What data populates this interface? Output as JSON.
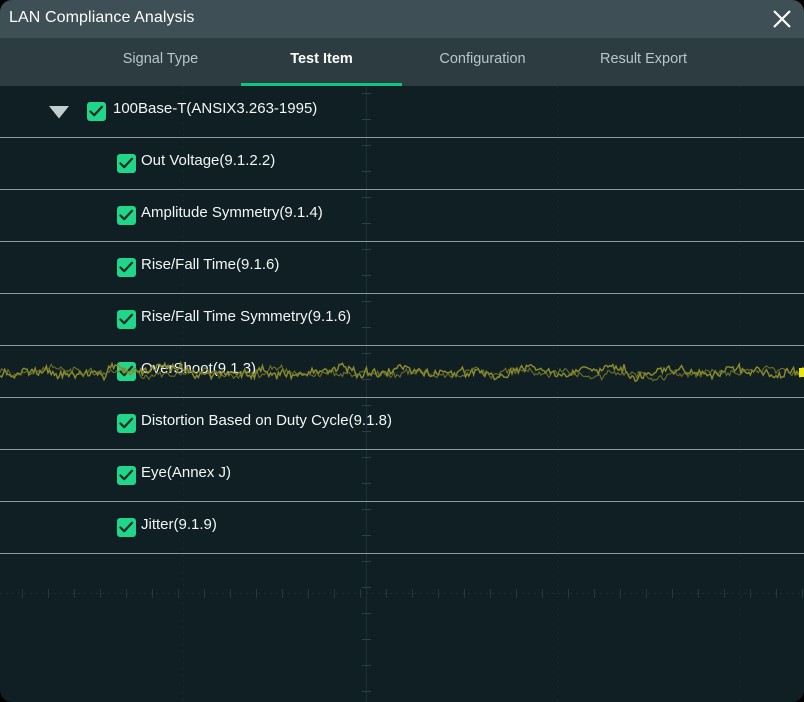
{
  "window": {
    "title": "LAN Compliance Analysis",
    "close_icon": "close-icon",
    "close_glyph": "✕"
  },
  "colors": {
    "titlebar_bg": "#3e5055",
    "tabbar_bg": "#2c3c41",
    "body_bg": "#101f23",
    "accent_green": "#0fc380",
    "checkbox_green": "#1fd68a",
    "row_separator": "#8b9b9c",
    "text_primary": "#f2f6f6",
    "text_inactive": "#b9c6c9",
    "waveform_trace": "#8d8d2e",
    "waveform_marker": "#e8e80b",
    "graticule": "#1b3035"
  },
  "tabs": [
    {
      "label": "Signal Type",
      "active": false,
      "name": "tab-signal-type"
    },
    {
      "label": "Test Item",
      "active": true,
      "name": "tab-test-item"
    },
    {
      "label": "Configuration",
      "active": false,
      "name": "tab-configuration"
    },
    {
      "label": "Result Export",
      "active": false,
      "name": "tab-result-export"
    }
  ],
  "tree": {
    "parent": {
      "label": "100Base-T(ANSIX3.263-1995)",
      "checked": true,
      "expanded": true,
      "expander_icon": "chevron-down-icon",
      "checkbox_icon": "check-icon"
    },
    "children": [
      {
        "label": "Out Voltage(9.1.2.2)",
        "checked": true
      },
      {
        "label": "Amplitude Symmetry(9.1.4)",
        "checked": true
      },
      {
        "label": "Rise/Fall Time(9.1.6)",
        "checked": true
      },
      {
        "label": "Rise/Fall Time Symmetry(9.1.6)",
        "checked": true
      },
      {
        "label": "OverShoot(9.1.3)",
        "checked": true
      },
      {
        "label": "Distortion Based on Duty Cycle(9.1.8)",
        "checked": true
      },
      {
        "label": "Eye(Annex J)",
        "checked": true
      },
      {
        "label": "Jitter(9.1.9)",
        "checked": true
      }
    ]
  }
}
